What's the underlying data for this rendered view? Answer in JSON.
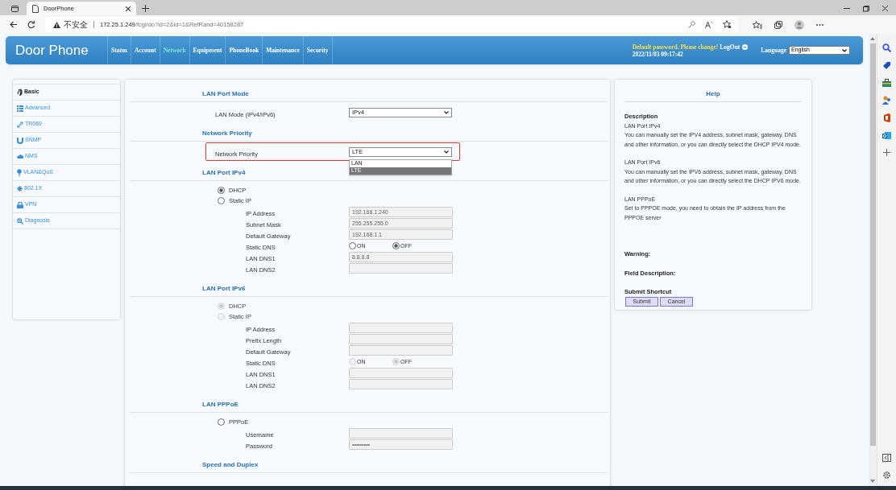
{
  "browser": {
    "tab_title": "DoorPhone",
    "address": {
      "security_label": "不安全",
      "host": "172.25.1.249",
      "path": "/fcgi/do?id=2&id=1&RefRand=40158287"
    }
  },
  "header": {
    "logo": "Door Phone",
    "nav": [
      {
        "label": "Status",
        "selected": false
      },
      {
        "label": "Account",
        "selected": false
      },
      {
        "label": "Network",
        "selected": true
      },
      {
        "label": "Equipment",
        "selected": false
      },
      {
        "label": "PhoneBook",
        "selected": false
      },
      {
        "label": "Maintenance",
        "selected": false
      },
      {
        "label": "Security",
        "selected": false
      }
    ],
    "warning": "Default password. Please change!",
    "logout": "LogOut",
    "datetime": "2022/11/03 09:17:42",
    "language_label": "Language",
    "language": "English"
  },
  "sidebar": {
    "items": [
      {
        "label": "Basic",
        "selected": true
      },
      {
        "label": "Advanced",
        "selected": false
      },
      {
        "label": "TR069",
        "selected": false
      },
      {
        "label": "SNMP",
        "selected": false
      },
      {
        "label": "NMS",
        "selected": false
      },
      {
        "label": "VLAN&QoS",
        "selected": false
      },
      {
        "label": "802.1X",
        "selected": false
      },
      {
        "label": "VPN",
        "selected": false
      },
      {
        "label": "Diagnosis",
        "selected": false
      }
    ]
  },
  "sections": [
    {
      "title": "LAN Port Mode",
      "rows": [
        {
          "kind": "select",
          "label": "LAN Mode (IPv4/IPv6)",
          "value": "IPv4",
          "highlighted": false
        }
      ]
    },
    {
      "title": "Network Priority",
      "rows": [
        {
          "kind": "select",
          "label": "Network Priority",
          "value": "LTE",
          "highlighted": true,
          "options": [
            {
              "label": "LAN",
              "selected": false
            },
            {
              "label": "LTE",
              "selected": true
            }
          ]
        }
      ]
    },
    {
      "title": "LAN Port IPv4",
      "rows": [
        {
          "kind": "radio",
          "label": "DHCP",
          "checked": true,
          "disabled": false
        },
        {
          "kind": "radio",
          "label": "Static IP",
          "checked": false,
          "disabled": false
        },
        {
          "kind": "input",
          "label": "IP Address",
          "value": "192.168.1.240"
        },
        {
          "kind": "input",
          "label": "Subnet Mask",
          "value": "255.255.255.0"
        },
        {
          "kind": "input",
          "label": "Default Gateway",
          "value": "192.168.1.1"
        },
        {
          "kind": "toggle",
          "label": "Static DNS",
          "disabled": false,
          "options": [
            {
              "label": "ON",
              "checked": false
            },
            {
              "label": "OFF",
              "checked": true
            }
          ]
        },
        {
          "kind": "input",
          "label": "LAN DNS1",
          "value": "8.8.8.8"
        },
        {
          "kind": "input",
          "label": "LAN DNS2"
        }
      ]
    },
    {
      "title": "LAN Port IPv6",
      "rows": [
        {
          "kind": "radio",
          "label": "DHCP",
          "checked": true,
          "disabled": true
        },
        {
          "kind": "radio",
          "label": "Static IP",
          "checked": false,
          "disabled": true
        },
        {
          "kind": "input",
          "label": "IP Address"
        },
        {
          "kind": "input",
          "label": "Prefix Length"
        },
        {
          "kind": "input",
          "label": "Default Gateway"
        },
        {
          "kind": "toggle",
          "label": "Static DNS",
          "disabled": true,
          "options": [
            {
              "label": "ON",
              "checked": false
            },
            {
              "label": "OFF",
              "checked": true
            }
          ]
        },
        {
          "kind": "input",
          "label": "LAN DNS1"
        },
        {
          "kind": "input",
          "label": "LAN DNS2"
        }
      ]
    },
    {
      "title": "LAN PPPoE",
      "rows": [
        {
          "kind": "radio",
          "label": "PPPoE",
          "checked": false,
          "disabled": false
        },
        {
          "kind": "input",
          "label": "Username"
        },
        {
          "kind": "input",
          "label": "Password",
          "value": "•••••••••"
        }
      ]
    },
    {
      "title": "Speed and Duplex"
    }
  ],
  "help": {
    "title": "Help",
    "description_heading": "Description",
    "entries": [
      {
        "title": "LAN Port IPv4",
        "text": "You can manually set the IPV4 address, subnet mask, gateway, DNS and other information, or you can directly select the DHCP IPV4 mode."
      },
      {
        "title": "LAN Port IPv6",
        "text": "You can manually set the IPV6 address, subnet mask, gateway, DNS and other information, or you can directly select the DHCP IPV6 mode."
      },
      {
        "title": "LAN PPPoE",
        "text": "Set to PPPOE mode, you need to obtain the IP address from the PPPOE server"
      }
    ],
    "warning": "Warning:",
    "field_description": "Field Description:",
    "shortcut_title": "Submit Shortcut",
    "buttons": [
      "Submit",
      "Cancel"
    ]
  }
}
